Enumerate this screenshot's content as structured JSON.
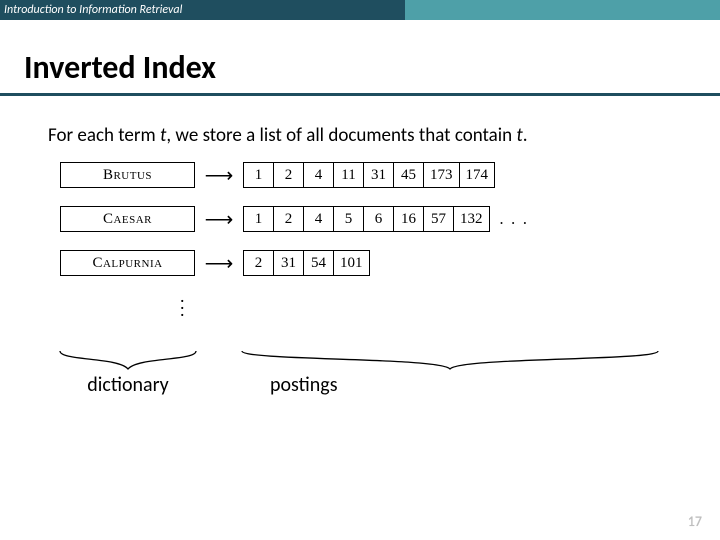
{
  "header": {
    "course": "Introduction to Information Retrieval"
  },
  "title": "Inverted Index",
  "description_pre": "For each term ",
  "description_mid1": "t",
  "description_mid2": ", we store a list of all documents that contain ",
  "description_mid3": "t",
  "description_post": ".",
  "terms": {
    "0": {
      "name": "Brutus",
      "postings": [
        "1",
        "2",
        "4",
        "11",
        "31",
        "45",
        "173",
        "174"
      ],
      "trailing": ""
    },
    "1": {
      "name": "Caesar",
      "postings": [
        "1",
        "2",
        "4",
        "5",
        "6",
        "16",
        "57",
        "132"
      ],
      "trailing": ". . ."
    },
    "2": {
      "name": "Calpurnia",
      "postings": [
        "2",
        "31",
        "54",
        "101"
      ],
      "trailing": ""
    }
  },
  "labels": {
    "dictionary": "dictionary",
    "postings": "postings"
  },
  "page": "17"
}
